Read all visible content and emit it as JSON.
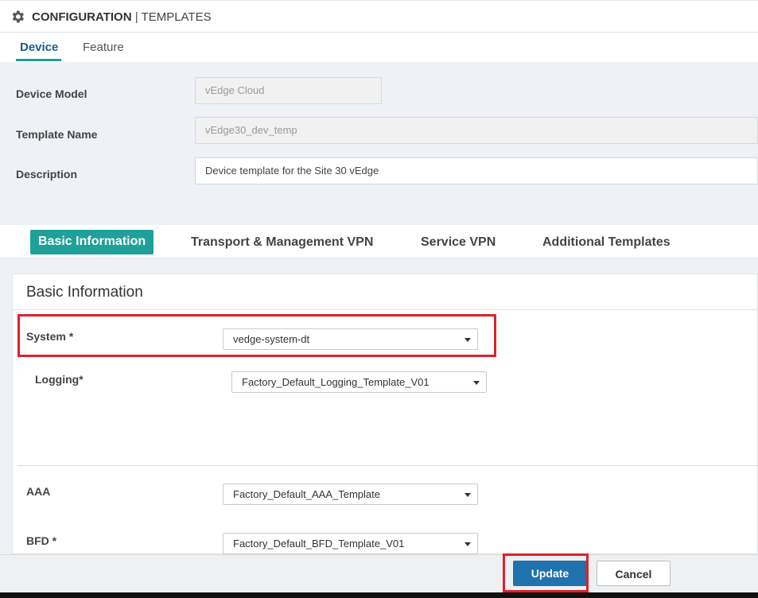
{
  "header": {
    "title_main": "CONFIGURATION",
    "title_sep": "|",
    "title_sub": "TEMPLATES"
  },
  "tabs": [
    {
      "label": "Device",
      "active": true
    },
    {
      "label": "Feature",
      "active": false
    }
  ],
  "form": {
    "device_model": {
      "label": "Device Model",
      "value": "vEdge Cloud"
    },
    "template_name": {
      "label": "Template Name",
      "value": "vEdge30_dev_temp"
    },
    "description": {
      "label": "Description",
      "value": "Device template for the Site 30 vEdge"
    }
  },
  "section_tabs": [
    {
      "label": "Basic Information",
      "active": true
    },
    {
      "label": "Transport & Management VPN",
      "active": false
    },
    {
      "label": "Service VPN",
      "active": false
    },
    {
      "label": "Additional Templates",
      "active": false
    }
  ],
  "basic_info": {
    "title": "Basic Information",
    "rows": [
      {
        "label": "System *",
        "value": "vedge-system-dt"
      },
      {
        "label": "Logging*",
        "value": "Factory_Default_Logging_Template_V01"
      },
      {
        "label": "AAA",
        "value": "Factory_Default_AAA_Template"
      },
      {
        "label": "BFD *",
        "value": "Factory_Default_BFD_Template_V01"
      }
    ]
  },
  "footer": {
    "update_label": "Update",
    "cancel_label": "Cancel"
  },
  "colors": {
    "accent_teal": "#1fa099",
    "primary_blue": "#1f72ad",
    "highlight_red": "#e0202a"
  },
  "icons": {
    "header_icon": "gear-icon",
    "dropdown_icon": "caret-down-icon"
  }
}
